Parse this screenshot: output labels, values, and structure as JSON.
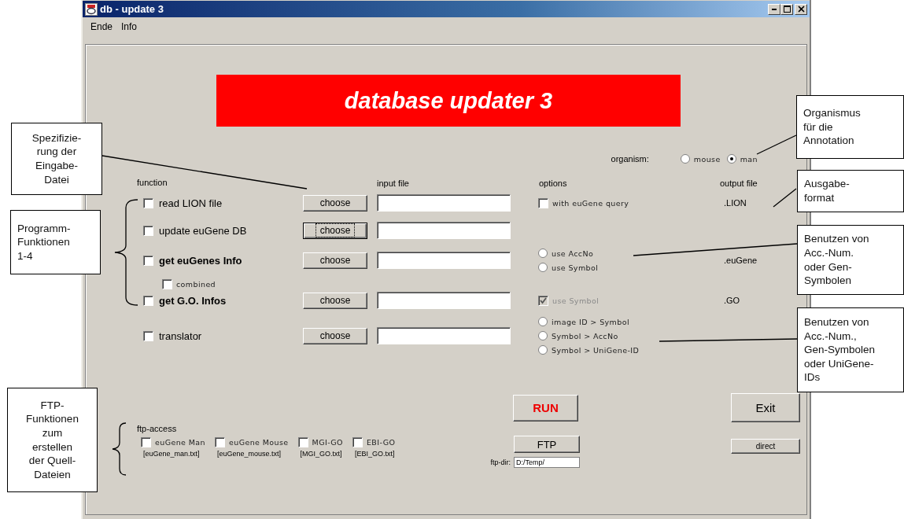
{
  "window": {
    "title": "db - update 3"
  },
  "menu": [
    "Ende",
    "Info"
  ],
  "banner": {
    "title": "database updater 3"
  },
  "organism": {
    "label": "organism:",
    "choices": [
      {
        "label": "mouse",
        "selected": false
      },
      {
        "label": "man",
        "selected": true
      }
    ]
  },
  "columns": {
    "function": "function",
    "input_file": "input file",
    "options": "options",
    "output_file": "output file"
  },
  "functions": [
    {
      "kind": "function",
      "label": "read LION file",
      "bold": false,
      "checked": false,
      "button": "choose",
      "focused": false,
      "options": [
        {
          "kind": "checkbox",
          "label": "with euGene query",
          "checked": false,
          "disabled": false
        }
      ],
      "output": ".LION"
    },
    {
      "kind": "function",
      "label": "update euGene DB",
      "bold": false,
      "checked": false,
      "button": "choose",
      "focused": true
    },
    {
      "kind": "function",
      "label": "get euGenes Info",
      "bold": true,
      "checked": false,
      "button": "choose",
      "focused": false,
      "options": [
        {
          "kind": "radio",
          "label": "use AccNo",
          "selected": false
        },
        {
          "kind": "radio",
          "label": "use Symbol",
          "selected": false
        }
      ],
      "output": ".euGene"
    },
    {
      "kind": "sub",
      "label": "combined",
      "checked": false
    },
    {
      "kind": "function",
      "label": "get G.O. Infos",
      "bold": true,
      "checked": false,
      "button": "choose",
      "focused": false,
      "options": [
        {
          "kind": "checkbox",
          "label": "use Symbol",
          "checked": true,
          "disabled": true
        }
      ],
      "output": ".GO"
    },
    {
      "kind": "function",
      "label": "translator",
      "bold": false,
      "checked": false,
      "button": "choose",
      "focused": false,
      "options": [
        {
          "kind": "radio",
          "label": "image ID > Symbol",
          "selected": false
        },
        {
          "kind": "radio",
          "label": "Symbol > AccNo",
          "selected": false
        },
        {
          "kind": "radio",
          "label": "Symbol > UniGene-ID",
          "selected": false
        }
      ]
    }
  ],
  "run_button": "RUN",
  "exit_button": "Exit",
  "ftp": {
    "label": "ftp-access",
    "sources": [
      {
        "label": "euGene Man",
        "checked": false,
        "file": "[euGene_man.txt]"
      },
      {
        "label": "euGene Mouse",
        "checked": false,
        "file": "[euGene_mouse.txt]"
      },
      {
        "label": "MGI-GO",
        "checked": false,
        "file": "[MGI_GO.txt]"
      },
      {
        "label": "EBI-GO",
        "checked": false,
        "file": "[EBI_GO.txt]"
      }
    ],
    "button": "FTP",
    "dir_label": "ftp-dir:",
    "dir_value": "D:/Temp/"
  },
  "direct_button": "direct",
  "annotations": [
    {
      "lines": [
        "Spezifizie-",
        "rung der",
        "Eingabe-",
        "Datei"
      ]
    },
    {
      "lines": [
        "Programm-",
        "Funktionen",
        "1-4"
      ]
    },
    {
      "lines": [
        "FTP-",
        "Funktionen",
        "zum",
        "erstellen",
        "der Quell-",
        "Dateien"
      ]
    },
    {
      "lines": [
        "Organismus",
        "für die",
        "Annotation"
      ]
    },
    {
      "lines": [
        "Ausgabe-",
        "format"
      ]
    },
    {
      "lines": [
        "Benutzen von",
        "Acc.-Num.",
        "oder Gen-",
        "Symbolen"
      ]
    },
    {
      "lines": [
        "Benutzen von",
        "Acc.-Num.,",
        "Gen-Symbolen",
        "oder UniGene-",
        "IDs"
      ]
    }
  ]
}
